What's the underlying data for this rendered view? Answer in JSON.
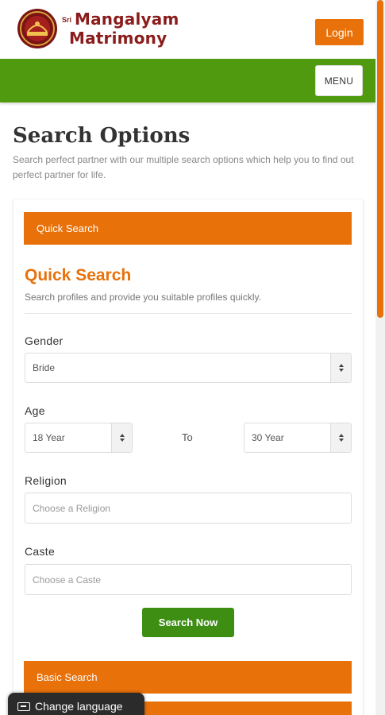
{
  "header": {
    "brand_prefix": "Sri",
    "brand_line1": "Mangalyam",
    "brand_line2": "Matrimony",
    "login_label": "Login",
    "menu_label": "MENU"
  },
  "page": {
    "title": "Search Options",
    "subtitle": "Search perfect partner with our multiple search options which help you to find out perfect partner for life."
  },
  "tabs": {
    "quick": "Quick Search",
    "basic": "Basic Search"
  },
  "quick_search": {
    "title": "Quick Search",
    "subtitle": "Search profiles and provide you suitable profiles quickly.",
    "gender_label": "Gender",
    "gender_value": "Bride",
    "age_label": "Age",
    "age_from": "18 Year",
    "age_to_text": "To",
    "age_to": "30 Year",
    "religion_label": "Religion",
    "religion_placeholder": "Choose a Religion",
    "caste_label": "Caste",
    "caste_placeholder": "Choose a Caste",
    "search_button": "Search Now"
  },
  "footer": {
    "change_language": "Change language"
  },
  "colors": {
    "accent": "#e8710a",
    "nav_green": "#4f9a0e",
    "button_green": "#3e8e14",
    "brand": "#8b1c1c"
  }
}
